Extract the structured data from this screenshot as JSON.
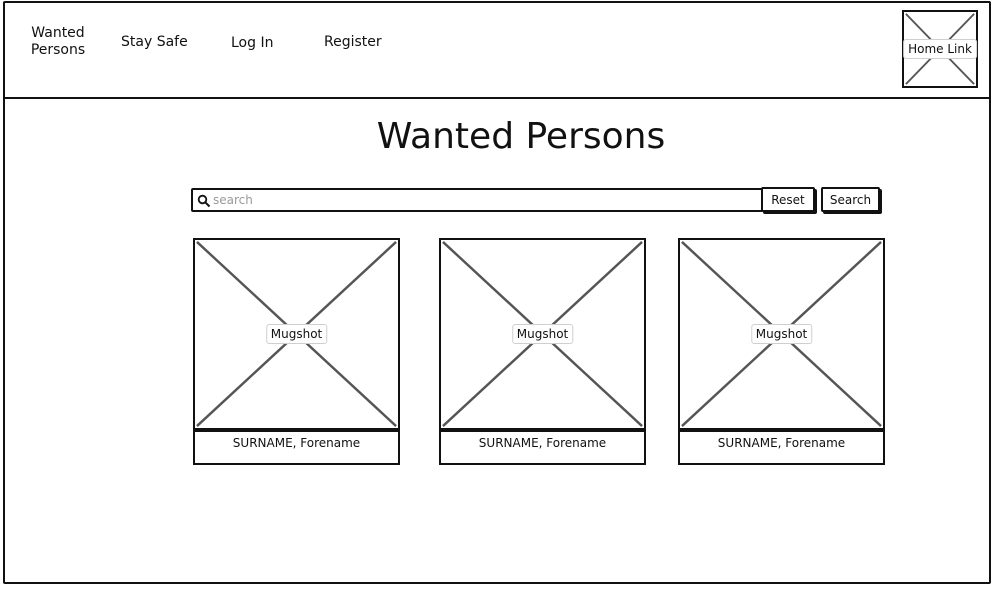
{
  "nav": {
    "wanted_persons": "Wanted Persons",
    "stay_safe": "Stay Safe",
    "log_in": "Log In",
    "register": "Register",
    "home_link": "Home Link"
  },
  "page": {
    "title": "Wanted Persons"
  },
  "search": {
    "placeholder": "search",
    "value": "",
    "reset_label": "Reset",
    "search_label": "Search",
    "icon": "search-icon"
  },
  "cards": [
    {
      "image_label": "Mugshot",
      "name": "SURNAME, Forename"
    },
    {
      "image_label": "Mugshot",
      "name": "SURNAME, Forename"
    },
    {
      "image_label": "Mugshot",
      "name": "SURNAME, Forename"
    }
  ],
  "colors": {
    "line": "#111111",
    "placeholder_cross": "#555555",
    "background": "#ffffff"
  }
}
